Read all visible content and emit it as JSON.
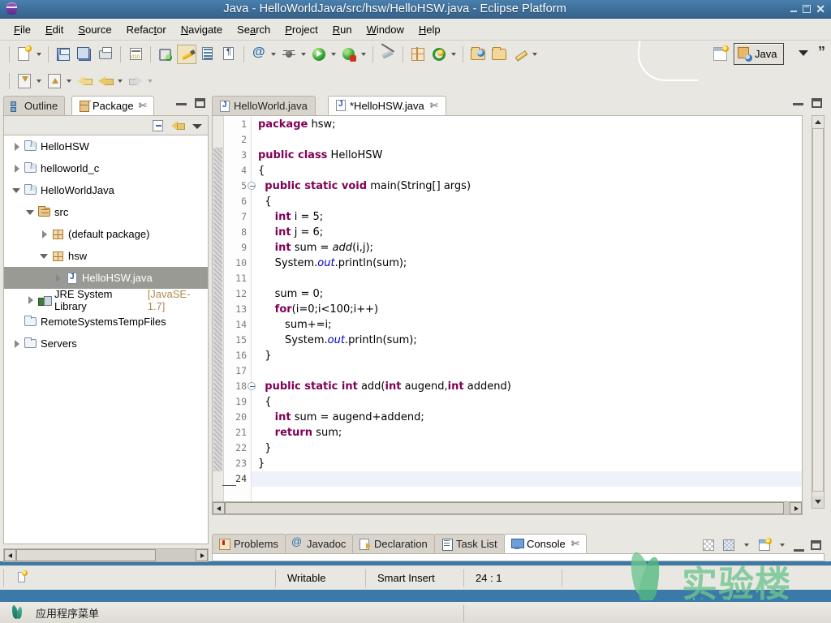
{
  "window": {
    "title": "Java - HelloWorldJava/src/hsw/HelloHSW.java - Eclipse Platform",
    "icon": "eclipse-icon",
    "minimize_label": "_",
    "maximize_label": "□",
    "close_label": "✕"
  },
  "menubar": {
    "items": [
      {
        "label": "File",
        "mnemonic": "F"
      },
      {
        "label": "Edit",
        "mnemonic": "E"
      },
      {
        "label": "Source",
        "mnemonic": "S"
      },
      {
        "label": "Refactor",
        "mnemonic": "t"
      },
      {
        "label": "Navigate",
        "mnemonic": "N"
      },
      {
        "label": "Search",
        "mnemonic": "a"
      },
      {
        "label": "Project",
        "mnemonic": "P"
      },
      {
        "label": "Run",
        "mnemonic": "R"
      },
      {
        "label": "Window",
        "mnemonic": "W"
      },
      {
        "label": "Help",
        "mnemonic": "H"
      }
    ]
  },
  "toolbar": {
    "row1": [
      {
        "name": "new-button",
        "icon": "new-page-icon",
        "has_arrow": true
      },
      {
        "name": "save-button",
        "icon": "save-icon",
        "has_arrow": false
      },
      {
        "name": "save-all-button",
        "icon": "save-all-icon",
        "has_arrow": false
      },
      {
        "name": "print-button",
        "icon": "print-icon",
        "has_arrow": false
      },
      {
        "name": "build-button",
        "icon": "binary-icon",
        "has_arrow": false
      },
      {
        "name": "open-type-button",
        "icon": "search-type-icon",
        "has_arrow": false
      },
      {
        "name": "toggle-markoccurrences-button",
        "icon": "pencil-highlight-icon",
        "has_arrow": false,
        "pressed": true
      },
      {
        "name": "toggle-breadcrumb-button",
        "icon": "table-icon",
        "has_arrow": false
      },
      {
        "name": "show-whitespace-button",
        "icon": "pilcrow-icon",
        "has_arrow": false
      },
      {
        "name": "new-annotation-button",
        "icon": "at-icon",
        "has_arrow": true
      },
      {
        "name": "debug-button",
        "icon": "bug-icon",
        "has_arrow": true
      },
      {
        "name": "run-button",
        "icon": "run-icon",
        "has_arrow": true
      },
      {
        "name": "external-tools-button",
        "icon": "run-external-icon",
        "has_arrow": true
      },
      {
        "name": "skip-breakpoints-button",
        "icon": "no-breakpoint-icon",
        "has_arrow": false
      },
      {
        "name": "new-java-class-button",
        "icon": "new-class-icon",
        "has_arrow": false
      },
      {
        "name": "new-package-button",
        "icon": "new-green-circle-icon",
        "has_arrow": true
      },
      {
        "name": "open-resource-button",
        "icon": "folder-globe-icon",
        "has_arrow": false
      },
      {
        "name": "open-folder-button",
        "icon": "folder-icon",
        "has_arrow": false
      },
      {
        "name": "quickfix-button",
        "icon": "brush-icon",
        "has_arrow": true
      }
    ],
    "row2": [
      {
        "name": "import-button",
        "icon": "import-icon",
        "has_arrow": true
      },
      {
        "name": "export-button",
        "icon": "export-icon",
        "has_arrow": true
      },
      {
        "name": "back-history-button",
        "icon": "back-yellow-arrow-icon",
        "has_arrow": false
      },
      {
        "name": "previous-annotation-button",
        "icon": "left-arrow-icon",
        "has_arrow": true
      },
      {
        "name": "next-annotation-button",
        "icon": "right-arrow-icon",
        "has_arrow": true,
        "dim": true
      }
    ],
    "perspective": {
      "open_perspective_icon": "open-perspective-icon",
      "active_label": "Java",
      "active_icon": "java-perspective-icon",
      "chevron_icon": "chevron-down-icon",
      "quote_icon": "double-quote-icon"
    }
  },
  "left_panel": {
    "tabs": [
      {
        "label": "Outline",
        "icon": "outline-icon",
        "active": false,
        "closable": false
      },
      {
        "label": "Package",
        "icon": "package-explorer-icon",
        "active": true,
        "closable": true
      }
    ],
    "close_glyph": "✄",
    "view_minimize": "minimize-icon",
    "view_maximize": "maximize-icon",
    "toolbar": [
      {
        "name": "collapse-all-button",
        "icon": "collapse-all-icon"
      },
      {
        "name": "link-with-editor-button",
        "icon": "link-with-editor-icon"
      },
      {
        "name": "view-menu-button",
        "icon": "chevron-down-icon"
      }
    ],
    "tree": [
      {
        "label": "HelloHSW",
        "icon": "java-project-icon",
        "indent": 0,
        "twist": "closed",
        "selected": false
      },
      {
        "label": "helloworld_c",
        "icon": "java-project-icon",
        "indent": 0,
        "twist": "closed",
        "selected": false
      },
      {
        "label": "HelloWorldJava",
        "icon": "java-project-icon",
        "indent": 0,
        "twist": "open",
        "selected": false
      },
      {
        "label": "src",
        "icon": "source-folder-icon",
        "indent": 1,
        "twist": "open",
        "selected": false
      },
      {
        "label": "(default package)",
        "icon": "package-icon",
        "indent": 2,
        "twist": "closed",
        "selected": false
      },
      {
        "label": "hsw",
        "icon": "package-icon",
        "indent": 2,
        "twist": "open",
        "selected": false
      },
      {
        "label": "HelloHSW.java",
        "icon": "java-file-icon",
        "indent": 3,
        "twist": "closed",
        "selected": true
      },
      {
        "label": "JRE System Library",
        "suffix": "[JavaSE-1.7]",
        "icon": "jre-library-icon",
        "indent": 1,
        "twist": "closed",
        "selected": false
      },
      {
        "label": "RemoteSystemsTempFiles",
        "icon": "folder-icon",
        "indent": 0,
        "twist": "none",
        "selected": false
      },
      {
        "label": "Servers",
        "icon": "folder-icon",
        "indent": 0,
        "twist": "closed",
        "selected": false
      }
    ]
  },
  "editor": {
    "tabs": [
      {
        "label": "HelloWorld.java",
        "icon": "java-file-icon",
        "active": false,
        "dirty": false,
        "closable": false
      },
      {
        "label": "*HelloHSW.java",
        "icon": "java-file-icon",
        "active": true,
        "dirty": true,
        "closable": true
      }
    ],
    "close_glyph": "✄",
    "view_minimize": "minimize-icon",
    "view_maximize": "maximize-icon",
    "line_count": 24,
    "current_line": 24,
    "lines": [
      {
        "n": 1,
        "fold": false,
        "ann": false,
        "html": "<span class='kw'>package</span> hsw;"
      },
      {
        "n": 2,
        "fold": false,
        "ann": false,
        "html": ""
      },
      {
        "n": 3,
        "fold": false,
        "ann": true,
        "html": "<span class='kw'>public class</span> HelloHSW"
      },
      {
        "n": 4,
        "fold": false,
        "ann": true,
        "html": "{"
      },
      {
        "n": 5,
        "fold": true,
        "ann": true,
        "html": "  <span class='kw'>public static void</span> main(String[] args)"
      },
      {
        "n": 6,
        "fold": false,
        "ann": true,
        "html": "  {"
      },
      {
        "n": 7,
        "fold": false,
        "ann": true,
        "html": "     <span class='kw'>int</span> i = 5;"
      },
      {
        "n": 8,
        "fold": false,
        "ann": true,
        "html": "     <span class='kw'>int</span> j = 6;"
      },
      {
        "n": 9,
        "fold": false,
        "ann": true,
        "html": "     <span class='kw'>int</span> sum = <span class='it'>add</span>(i,j);"
      },
      {
        "n": 10,
        "fold": false,
        "ann": true,
        "html": "     System.<span class='itb'>out</span>.println(sum);"
      },
      {
        "n": 11,
        "fold": false,
        "ann": true,
        "html": ""
      },
      {
        "n": 12,
        "fold": false,
        "ann": true,
        "html": "     sum = 0;"
      },
      {
        "n": 13,
        "fold": false,
        "ann": true,
        "html": "     <span class='kw'>for</span>(i=0;i&lt;100;i++)"
      },
      {
        "n": 14,
        "fold": false,
        "ann": true,
        "html": "        sum+=i;"
      },
      {
        "n": 15,
        "fold": false,
        "ann": true,
        "html": "        System.<span class='itb'>out</span>.println(sum);"
      },
      {
        "n": 16,
        "fold": false,
        "ann": true,
        "html": "  }"
      },
      {
        "n": 17,
        "fold": false,
        "ann": true,
        "html": ""
      },
      {
        "n": 18,
        "fold": true,
        "ann": true,
        "html": "  <span class='kw'>public static int</span> add(<span class='kw'>int</span> augend,<span class='kw'>int</span> addend)"
      },
      {
        "n": 19,
        "fold": false,
        "ann": true,
        "html": "  {"
      },
      {
        "n": 20,
        "fold": false,
        "ann": true,
        "html": "     <span class='kw'>int</span> sum = augend+addend;"
      },
      {
        "n": 21,
        "fold": false,
        "ann": true,
        "html": "     <span class='kw'>return</span> sum;"
      },
      {
        "n": 22,
        "fold": false,
        "ann": true,
        "html": "  }"
      },
      {
        "n": 23,
        "fold": false,
        "ann": true,
        "html": "}"
      },
      {
        "n": 24,
        "fold": false,
        "ann": false,
        "html": "",
        "highlight": true
      }
    ]
  },
  "bottom_panel": {
    "tabs": [
      {
        "label": "Problems",
        "icon": "problems-icon",
        "active": false,
        "closable": false
      },
      {
        "label": "Javadoc",
        "icon": "javadoc-icon",
        "active": false,
        "closable": false
      },
      {
        "label": "Declaration",
        "icon": "declaration-icon",
        "active": false,
        "closable": false
      },
      {
        "label": "Task List",
        "icon": "task-list-icon",
        "active": false,
        "closable": false
      },
      {
        "label": "Console",
        "icon": "console-icon",
        "active": true,
        "closable": true
      }
    ],
    "close_glyph": "✄",
    "toolbar": [
      {
        "name": "clear-console-button",
        "icon": "clear-console-icon"
      },
      {
        "name": "scroll-lock-button",
        "icon": "scroll-lock-icon",
        "has_arrow": true
      },
      {
        "name": "open-console-button",
        "icon": "new-console-icon",
        "has_arrow": true
      }
    ],
    "view_minimize": "minimize-icon",
    "view_maximize": "maximize-icon"
  },
  "statusbar": {
    "icon": "writable-doc-icon",
    "writable": "Writable",
    "insert_mode": "Smart Insert",
    "position": "24 : 1"
  },
  "taskbar": {
    "logo": "shiyanlou-logo-icon",
    "label": "应用程序菜单"
  },
  "watermark": {
    "cn": "实验楼",
    "en": "shiyanlou.com",
    "color": "#6cc58f"
  },
  "colors": {
    "title_bar": "#3e6f9b",
    "chrome": "#e9e7e2",
    "keyword": "#7f0055",
    "field": "#0000c0",
    "selection": "#9a9a94",
    "current_line": "#eef3fb",
    "accent": "#3b7aa8"
  }
}
